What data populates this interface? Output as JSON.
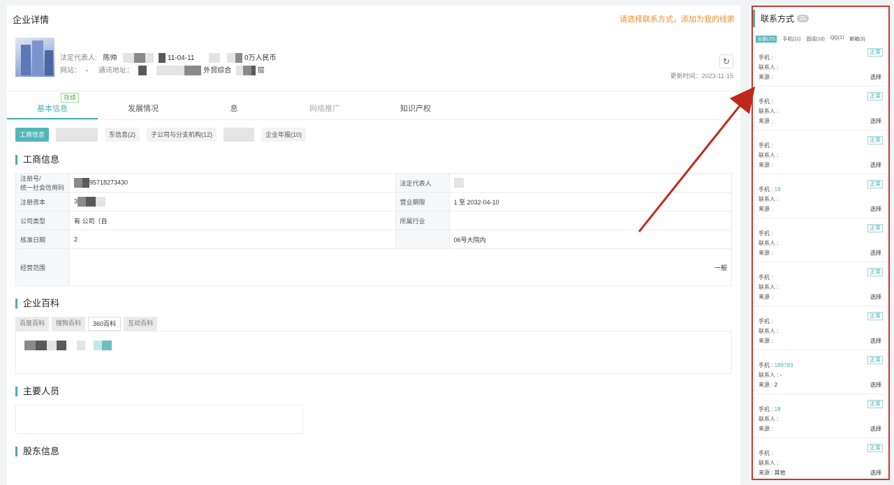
{
  "header": {
    "title": "企业详情",
    "tip": "请选择联系方式，添加为我的线索"
  },
  "company": {
    "legal_rep_label": "法定代表人:",
    "legal_rep_value": "陈帅",
    "date_fragment": "11-04-11",
    "capital_fragment": "0万人民币",
    "website_label": "网站：",
    "website_value": "-",
    "address_label": "通讯地址：",
    "address_fragment1": "外贸综合",
    "address_fragment2": "层",
    "status_tag": "存续",
    "update_label": "更新时间：2023-11-15",
    "refresh_icon": "refresh-icon"
  },
  "tabs": [
    {
      "label": "基本信息"
    },
    {
      "label": "发展情况"
    },
    {
      "label": "息"
    },
    {
      "label": "网络推广"
    },
    {
      "label": "知识产权"
    }
  ],
  "chips": [
    {
      "label": "工商信息"
    },
    {
      "label": "东信息(2)"
    },
    {
      "label": "子公司与分支机构(12)"
    },
    {
      "label": "企业年报(10)"
    }
  ],
  "sections": {
    "biz": "工商信息",
    "encyc": "企业百科",
    "people": "主要人员",
    "shareholders": "股东信息"
  },
  "biz_table": {
    "rows": [
      {
        "k1": "注册号/\n统一社会信用码",
        "v1": "95718273430",
        "k2": "法定代表人",
        "v2": ""
      },
      {
        "k1": "注册资本",
        "v1": "3",
        "k2": "营业期限",
        "v2": "1 至 2032-04-10"
      },
      {
        "k1": "公司类型",
        "v1": "有        公司（自",
        "k2": "所属行业",
        "v2": ""
      },
      {
        "k1": "核准日期",
        "v1": "2",
        "k2": "",
        "v2": "06号大院内"
      },
      {
        "k1": "经营范围",
        "v1": "",
        "k2": "",
        "v2": "一般"
      }
    ]
  },
  "encyc_tabs": [
    {
      "label": "百度百科"
    },
    {
      "label": "搜狗百科"
    },
    {
      "label": "360百科"
    },
    {
      "label": "互动百科"
    }
  ],
  "side": {
    "title": "联系方式",
    "count": "25",
    "tabs": [
      {
        "label": "全部(25)"
      },
      {
        "label": "手机(11)"
      },
      {
        "label": "固话(10)"
      },
      {
        "label": "QQ(1)"
      },
      {
        "label": "邮箱(3)"
      }
    ],
    "labels": {
      "phone": "手机",
      "contact": "联系人",
      "source": "来源",
      "select": "选择",
      "normal": "正常"
    },
    "cards": [
      {
        "phone": "",
        "contact": "",
        "source": ""
      },
      {
        "phone": "",
        "contact": "",
        "source": ""
      },
      {
        "phone": "",
        "contact": "",
        "source": ""
      },
      {
        "phone": "18",
        "contact": "",
        "source": ""
      },
      {
        "phone": "",
        "contact": "",
        "source": ""
      },
      {
        "phone": "",
        "contact": "",
        "source": ""
      },
      {
        "phone": "",
        "contact": "",
        "source": ""
      },
      {
        "phone": "189783",
        "contact": "-",
        "source": "2"
      },
      {
        "phone": "18",
        "contact": "",
        "source": ""
      },
      {
        "phone": "",
        "contact": "",
        "source": "其他"
      }
    ]
  }
}
